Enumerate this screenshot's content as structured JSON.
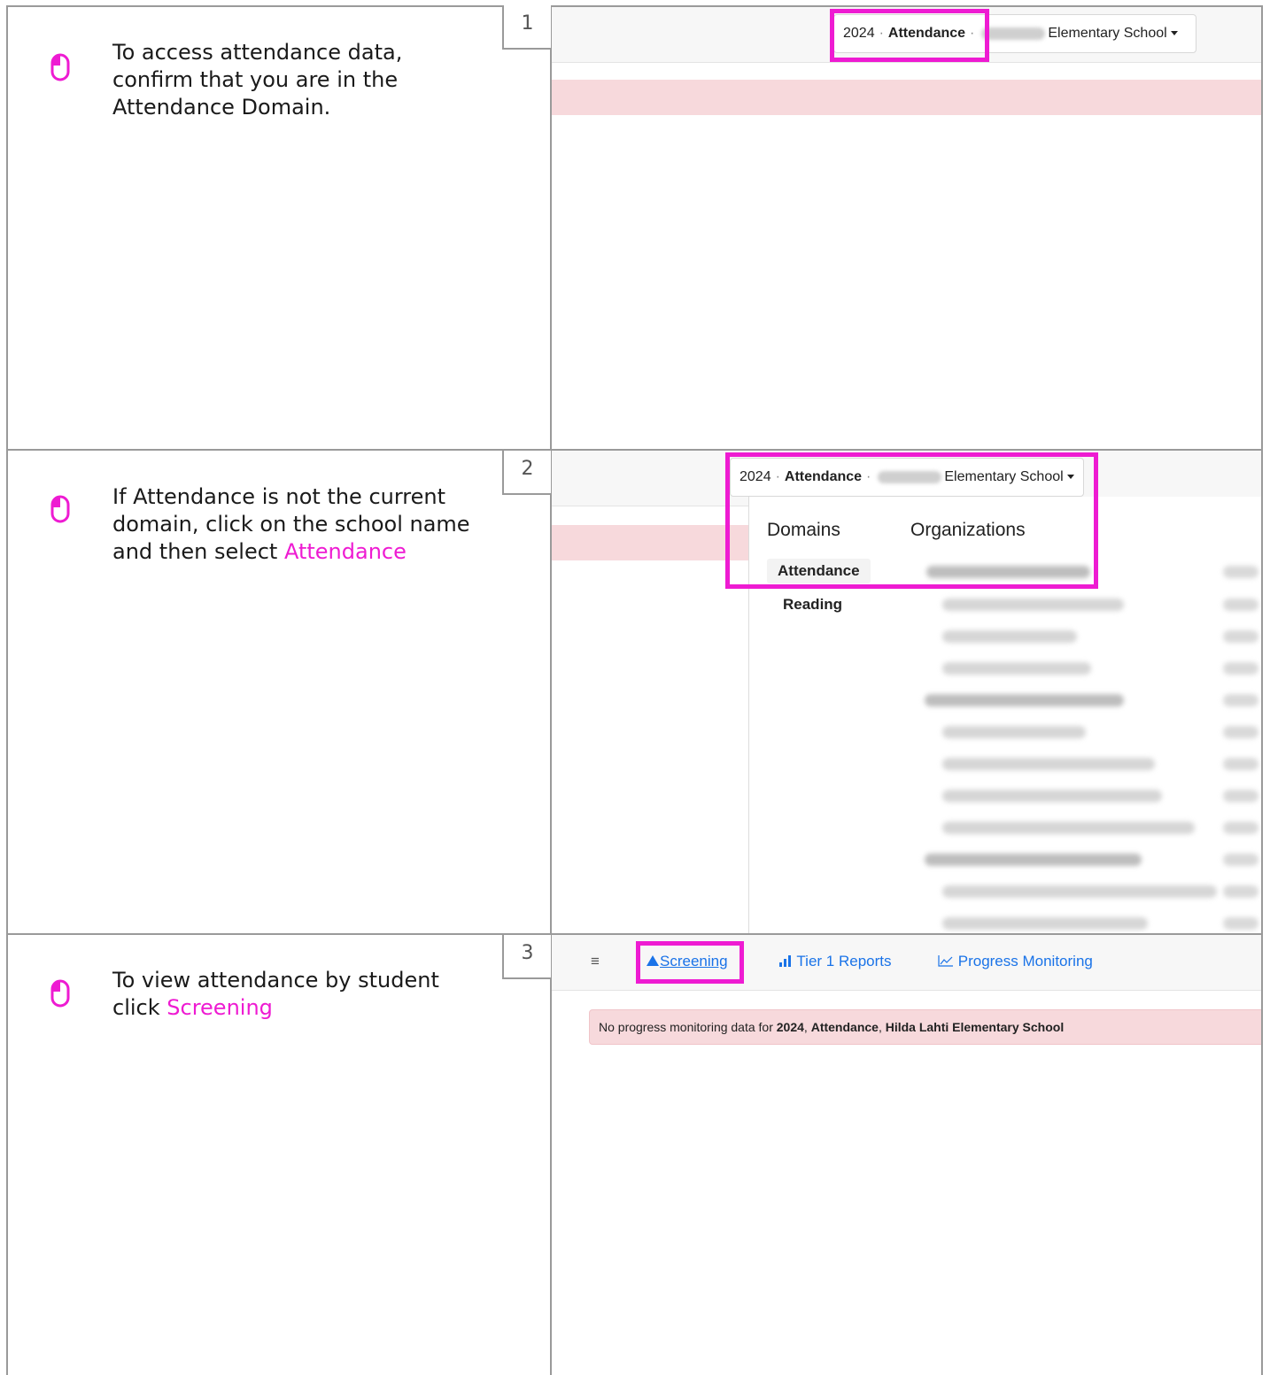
{
  "steps": [
    {
      "number": "1",
      "text": "To access attendance data, confirm that you are in the Attendance Domain."
    },
    {
      "number": "2",
      "text": "If Attendance is not the current domain, click on the school name and then select ",
      "highlight": "Attendance"
    },
    {
      "number": "3",
      "text": "To view attendance by student click ",
      "highlight": "Screening"
    }
  ],
  "selector": {
    "year": "2024",
    "domain": "Attendance",
    "school": "Elementary School"
  },
  "menu": {
    "domains_header": "Domains",
    "organizations_header": "Organizations",
    "domains": [
      "Attendance",
      "Reading"
    ]
  },
  "nav": {
    "menu_glyph": "≡",
    "screening": "Screening",
    "tier1": "Tier 1 Reports",
    "progress": "Progress Monitoring"
  },
  "alert": {
    "prefix": "No progress monitoring data for ",
    "year": "2024",
    "domain": "Attendance",
    "school": "Hilda Lahti Elementary School"
  },
  "colors": {
    "highlight": "#ee1bd2",
    "link": "#1a73e8",
    "alert_bg": "#f7d9dc",
    "border": "#9a9a9a"
  }
}
